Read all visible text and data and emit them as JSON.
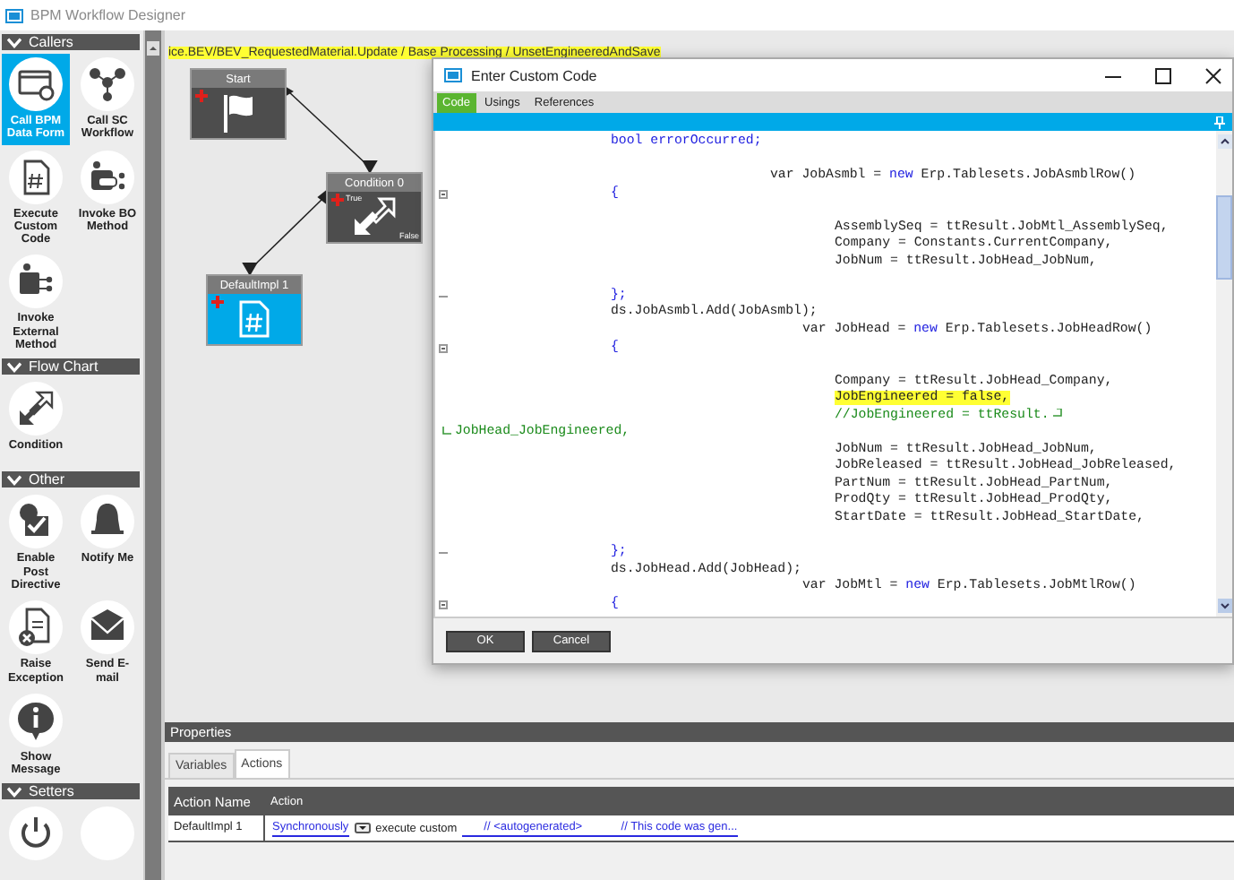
{
  "app": {
    "title": "BPM Workflow Designer"
  },
  "palette": [
    {
      "title": "Callers",
      "items": [
        {
          "label": "Call BPM Data Form",
          "kind": "form",
          "selected": true
        },
        {
          "label": "Call SC Workflow",
          "kind": "network",
          "selected": false
        },
        {
          "label": "Execute Custom Code",
          "kind": "custom_code",
          "selected": false
        },
        {
          "label": "Invoke BO Method",
          "kind": "bo_method",
          "selected": false
        },
        {
          "label": "Invoke External Method",
          "kind": "external",
          "selected": false
        }
      ]
    },
    {
      "title": "Flow Chart",
      "items": [
        {
          "label": "Condition",
          "kind": "condition",
          "selected": false
        }
      ]
    },
    {
      "title": "Other",
      "items": [
        {
          "label": "Enable Post Directive",
          "kind": "post_directive",
          "selected": false
        },
        {
          "label": "Notify Me",
          "kind": "bell",
          "selected": false
        },
        {
          "label": "Raise Exception",
          "kind": "exception",
          "selected": false
        },
        {
          "label": "Send E-mail",
          "kind": "email",
          "selected": false
        },
        {
          "label": "Show Message",
          "kind": "info",
          "selected": false
        }
      ]
    },
    {
      "title": "Setters",
      "items": [
        {
          "kind": "timer",
          "selected": false
        },
        {
          "kind": "plain",
          "selected": false
        }
      ]
    }
  ],
  "canvas": {
    "breadcrumb": "ice.BEV/BEV_RequestedMaterial.Update / Base Processing / UnsetEngineeredAndSave",
    "nodes": [
      {
        "title": "Start",
        "kind": "start"
      },
      {
        "title": "Condition 0",
        "kind": "condition",
        "true_label": "True",
        "false_label": "False"
      },
      {
        "title": "DefaultImpl 1",
        "kind": "custom_code"
      }
    ]
  },
  "dialog": {
    "title": "Enter Custom Code",
    "tabs": [
      {
        "label": "Code",
        "selected": true
      },
      {
        "label": "Usings",
        "selected": false
      },
      {
        "label": "References",
        "selected": false
      }
    ],
    "code": [
      {
        "kind": "block",
        "highlighted": false,
        "parts": [
          {
            "text": "bool errorOccurred;",
            "kind": "keyword"
          }
        ]
      },
      {
        "kind": "blank"
      },
      {
        "kind": "declaration",
        "highlighted": false,
        "parts": [
          {
            "text": "var JobAsmbl = ",
            "kind": "plain"
          },
          {
            "text": "new",
            "kind": "keyword"
          },
          {
            "text": " Erp.Tablesets.JobAsmblRow()",
            "kind": "plain"
          }
        ]
      },
      {
        "kind": "block_open",
        "highlighted": false,
        "parts": [
          {
            "text": "{",
            "kind": "keyword"
          }
        ]
      },
      {
        "kind": "blank"
      },
      {
        "kind": "member",
        "highlighted": false,
        "parts": [
          {
            "text": "AssemblySeq = ttResult.JobMtl_AssemblySeq,",
            "kind": "plain"
          }
        ]
      },
      {
        "kind": "member",
        "highlighted": false,
        "parts": [
          {
            "text": "Company = Constants.CurrentCompany,",
            "kind": "plain"
          }
        ]
      },
      {
        "kind": "member",
        "highlighted": false,
        "parts": [
          {
            "text": "JobNum = ttResult.JobHead_JobNum,",
            "kind": "plain"
          }
        ]
      },
      {
        "kind": "blank"
      },
      {
        "kind": "block_close",
        "highlighted": false,
        "parts": [
          {
            "text": "};",
            "kind": "keyword"
          }
        ]
      },
      {
        "kind": "block",
        "highlighted": false,
        "parts": [
          {
            "text": "ds.JobAsmbl.Add(JobAsmbl);",
            "kind": "plain"
          }
        ]
      },
      {
        "kind": "declaration_deep",
        "highlighted": false,
        "parts": [
          {
            "text": "var JobHead = ",
            "kind": "plain"
          },
          {
            "text": "new",
            "kind": "keyword"
          },
          {
            "text": " Erp.Tablesets.JobHeadRow()",
            "kind": "plain"
          }
        ]
      },
      {
        "kind": "block_open",
        "highlighted": false,
        "parts": [
          {
            "text": "{",
            "kind": "keyword"
          }
        ]
      },
      {
        "kind": "blank"
      },
      {
        "kind": "member",
        "highlighted": false,
        "parts": [
          {
            "text": "Company = ttResult.JobHead_Company,",
            "kind": "plain"
          }
        ]
      },
      {
        "kind": "member",
        "highlighted": true,
        "parts": [
          {
            "text": "JobEngineered = false,",
            "kind": "plain"
          }
        ]
      },
      {
        "kind": "member_wrapping",
        "highlighted": false,
        "parts": [
          {
            "text": "//JobEngineered = ttResult.",
            "kind": "comment"
          }
        ]
      },
      {
        "kind": "continuation",
        "highlighted": false,
        "parts": [
          {
            "text": "JobHead_JobEngineered,",
            "kind": "comment"
          }
        ]
      },
      {
        "kind": "member",
        "highlighted": false,
        "parts": [
          {
            "text": "JobNum = ttResult.JobHead_JobNum,",
            "kind": "plain"
          }
        ]
      },
      {
        "kind": "member",
        "highlighted": false,
        "parts": [
          {
            "text": "JobReleased = ttResult.JobHead_JobReleased,",
            "kind": "plain"
          }
        ]
      },
      {
        "kind": "member",
        "highlighted": false,
        "parts": [
          {
            "text": "PartNum = ttResult.JobHead_PartNum,",
            "kind": "plain"
          }
        ]
      },
      {
        "kind": "member",
        "highlighted": false,
        "parts": [
          {
            "text": "ProdQty = ttResult.JobHead_ProdQty,",
            "kind": "plain"
          }
        ]
      },
      {
        "kind": "member",
        "highlighted": false,
        "parts": [
          {
            "text": "StartDate = ttResult.JobHead_StartDate,",
            "kind": "plain"
          }
        ]
      },
      {
        "kind": "blank"
      },
      {
        "kind": "block_close",
        "highlighted": false,
        "parts": [
          {
            "text": "};",
            "kind": "keyword"
          }
        ]
      },
      {
        "kind": "block",
        "highlighted": false,
        "parts": [
          {
            "text": "ds.JobHead.Add(JobHead);",
            "kind": "plain"
          }
        ]
      },
      {
        "kind": "declaration_deep",
        "highlighted": false,
        "parts": [
          {
            "text": "var JobMtl = ",
            "kind": "plain"
          },
          {
            "text": "new",
            "kind": "keyword"
          },
          {
            "text": " Erp.Tablesets.JobMtlRow()",
            "kind": "plain"
          }
        ]
      },
      {
        "kind": "block_open",
        "highlighted": false,
        "parts": [
          {
            "text": "{",
            "kind": "keyword"
          }
        ]
      }
    ],
    "buttons": [
      "OK",
      "Cancel"
    ]
  },
  "properties": {
    "title": "Properties",
    "tabs": [
      {
        "label": "Variables",
        "selected": false
      },
      {
        "label": "Actions",
        "selected": true
      }
    ],
    "columns": [
      "Action Name",
      "Action"
    ],
    "rows": [
      {
        "action_name": "DefaultImpl 1",
        "mode": "Synchronously",
        "verb": "execute custom",
        "code_link": "// <autogenerated>            // This code was gen..."
      }
    ]
  }
}
